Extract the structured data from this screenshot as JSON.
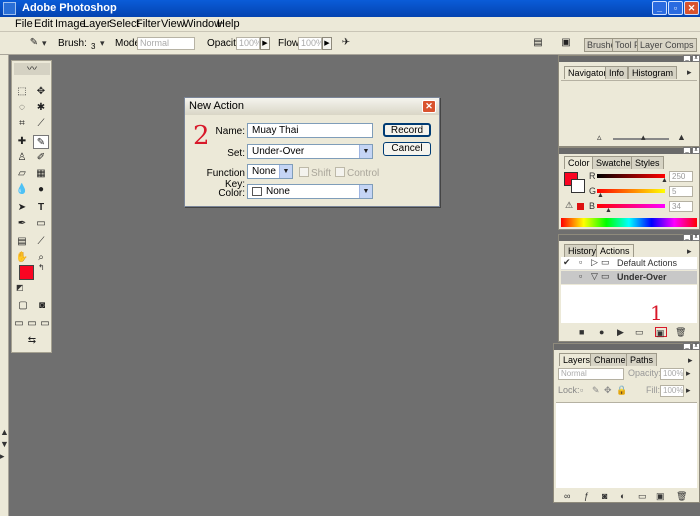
{
  "app": {
    "title": "Adobe Photoshop"
  },
  "menu": [
    "File",
    "Edit",
    "Image",
    "Layer",
    "Select",
    "Filter",
    "View",
    "Window",
    "Help"
  ],
  "options": {
    "brush_label": "Brush:",
    "brush_size": "3",
    "mode_label": "Mode:",
    "mode_value": "Normal",
    "opacity_label": "Opacity:",
    "opacity_value": "100%",
    "flow_label": "Flow:",
    "flow_value": "100%"
  },
  "palette_well": [
    "Brushes",
    "Tool Pr",
    "Layer Comps"
  ],
  "dialog": {
    "title": "New Action",
    "name_label": "Name:",
    "name_value": "Muay Thai",
    "set_label": "Set:",
    "set_value": "Under-Over",
    "fkey_label": "Function Key:",
    "fkey_value": "None",
    "shift_label": "Shift",
    "control_label": "Control",
    "color_label": "Color:",
    "color_value": "None",
    "record_label": "Record",
    "cancel_label": "Cancel"
  },
  "navigator": {
    "tabs": [
      "Navigator",
      "Info",
      "Histogram"
    ]
  },
  "color": {
    "tabs": [
      "Color",
      "Swatches",
      "Styles"
    ],
    "r_label": "R",
    "r_value": "250",
    "g_label": "G",
    "g_value": "5",
    "b_label": "B",
    "b_value": "34",
    "fg_color": "#fa0522"
  },
  "actions": {
    "tabs": [
      "History",
      "Actions"
    ],
    "items": [
      "Default Actions",
      "Under-Over"
    ]
  },
  "layers": {
    "tabs": [
      "Layers",
      "Channels",
      "Paths"
    ],
    "mode": "Normal",
    "opacity_label": "Opacity:",
    "opacity_value": "100%",
    "lock_label": "Lock:",
    "fill_label": "Fill:",
    "fill_value": "100%"
  },
  "annotations": {
    "one": "1",
    "two": "2"
  }
}
